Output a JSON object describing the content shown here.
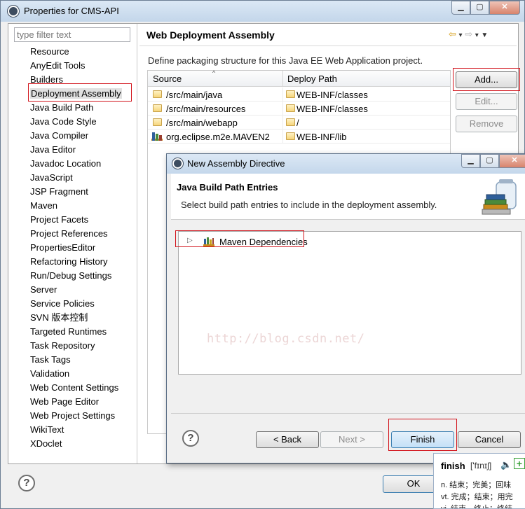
{
  "window": {
    "title": "Properties for CMS-API"
  },
  "sidebar": {
    "filter_placeholder": "type filter text",
    "items": [
      "Resource",
      "AnyEdit Tools",
      "Builders",
      "Deployment Assembly",
      "Java Build Path",
      "Java Code Style",
      "Java Compiler",
      "Java Editor",
      "Javadoc Location",
      "JavaScript",
      "JSP Fragment",
      "Maven",
      "Project Facets",
      "Project References",
      "PropertiesEditor",
      "Refactoring History",
      "Run/Debug Settings",
      "Server",
      "Service Policies",
      "SVN 版本控制",
      "Targeted Runtimes",
      "Task Repository",
      "Task Tags",
      "Validation",
      "Web Content Settings",
      "Web Page Editor",
      "Web Project Settings",
      "WikiText",
      "XDoclet"
    ],
    "selected": "Deployment Assembly"
  },
  "pane": {
    "title": "Web Deployment Assembly",
    "description": "Define packaging structure for this Java EE Web Application project.",
    "columns": {
      "source": "Source",
      "deploy_path": "Deploy Path"
    },
    "rows": [
      {
        "source": "/src/main/java",
        "deploy": "WEB-INF/classes",
        "icon": "folder-icon"
      },
      {
        "source": "/src/main/resources",
        "deploy": "WEB-INF/classes",
        "icon": "folder-icon"
      },
      {
        "source": "/src/main/webapp",
        "deploy": "/",
        "icon": "folder-icon"
      },
      {
        "source": "org.eclipse.m2e.MAVEN2",
        "deploy": "WEB-INF/lib",
        "icon": "library-icon"
      }
    ],
    "buttons": {
      "add": "Add...",
      "edit": "Edit...",
      "remove": "Remove"
    }
  },
  "footer": {
    "ok": "OK"
  },
  "dialog": {
    "title": "New Assembly Directive",
    "header_title": "Java Build Path Entries",
    "header_desc": "Select build path entries to include in the deployment assembly.",
    "tree_item": "Maven Dependencies",
    "watermark": "http://blog.csdn.net/",
    "buttons": {
      "back": "< Back",
      "next": "Next >",
      "finish": "Finish",
      "cancel": "Cancel"
    }
  },
  "dictionary": {
    "word": "finish",
    "phonetic": "['fɪnɪʃ]",
    "definitions": [
      "n. 结束；完美；回味",
      "vt. 完成；结束；用完",
      "vi. 结束，终止；终结"
    ]
  },
  "colors": {
    "highlight": "#d2141c",
    "title_gradient_top": "#dbe8f5",
    "folder": "#f6d57c"
  }
}
